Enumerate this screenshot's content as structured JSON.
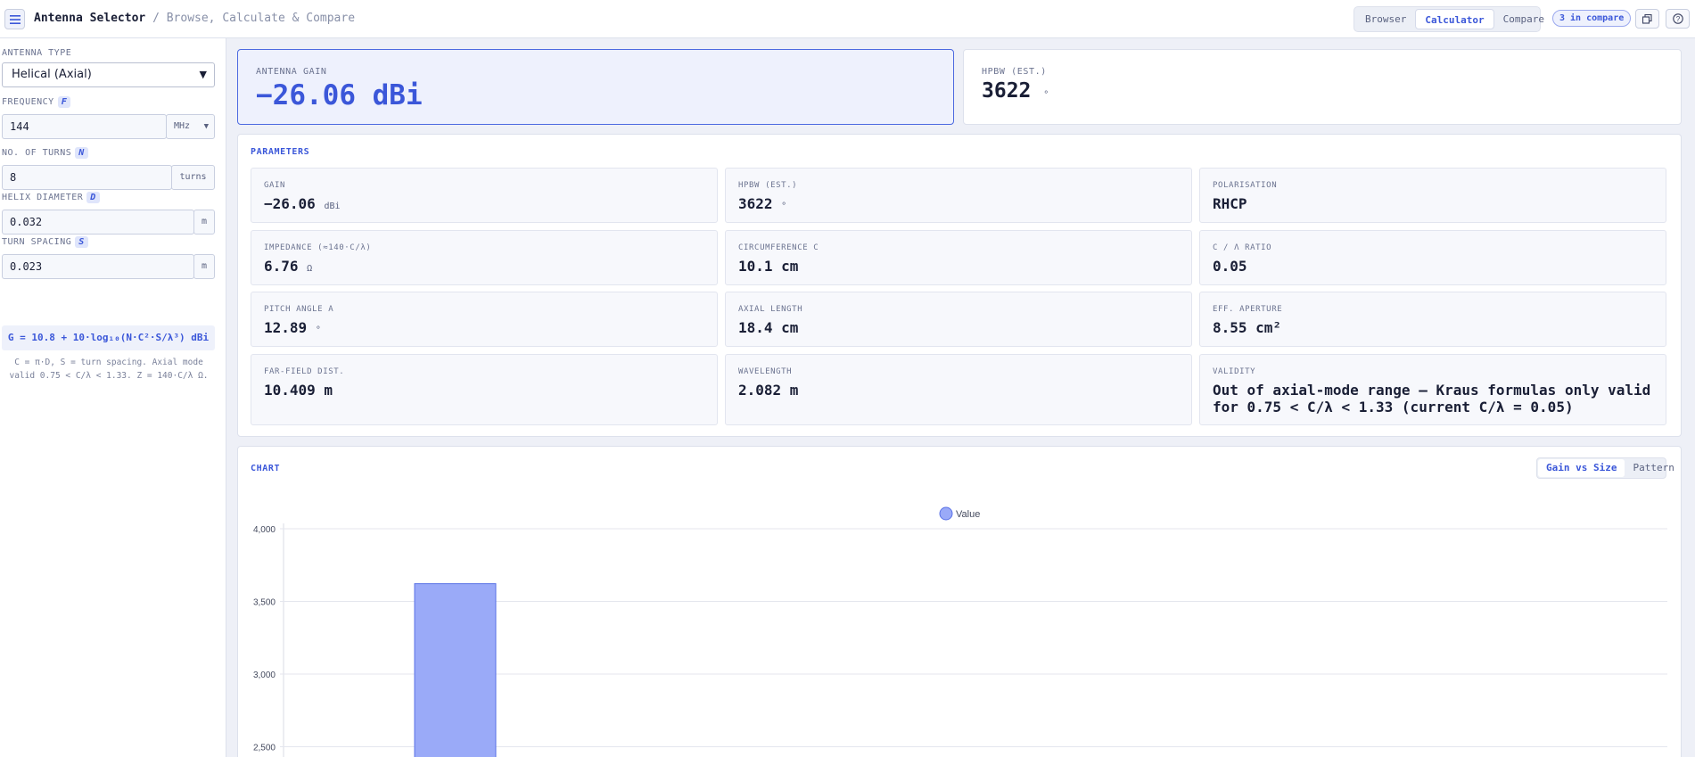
{
  "header": {
    "app_title": "Antenna Selector",
    "subtitle": "/ Browse, Calculate & Compare",
    "modes": [
      "Browser",
      "Calculator",
      "Compare"
    ],
    "active_mode": "Calculator",
    "compare_badge": "3 in compare"
  },
  "sidebar": {
    "antenna_type_label": "ANTENNA TYPE",
    "antenna_type_value": "Helical (Axial)",
    "frequency_label": "FREQUENCY",
    "frequency_var": "F",
    "frequency_value": "144",
    "frequency_unit": "MHz",
    "turns_label": "NO. OF TURNS",
    "turns_var": "N",
    "turns_value": "8",
    "turns_unit": "turns",
    "diameter_label": "HELIX DIAMETER",
    "diameter_var": "D",
    "diameter_value": "0.032",
    "diameter_unit": "m",
    "spacing_label": "TURN SPACING",
    "spacing_var": "S",
    "spacing_value": "0.023",
    "spacing_unit": "m",
    "formula": "G = 10.8 + 10·log₁₀(N·C²·S/λ³) dBi",
    "note": "C = π·D, S = turn spacing. Axial mode valid 0.75 < C/λ < 1.33. Z = 140·C/λ Ω."
  },
  "summary": {
    "gain_label": "ANTENNA GAIN",
    "gain_value": "−26.06 dBi",
    "hpbw_label": "HPBW (EST.)",
    "hpbw_value": "3622",
    "hpbw_unit": "°"
  },
  "parameters": {
    "title": "PARAMETERS",
    "items": [
      {
        "label": "GAIN",
        "value": "−26.06",
        "unit": "dBi"
      },
      {
        "label": "HPBW (EST.)",
        "value": "3622",
        "unit": "°"
      },
      {
        "label": "POLARISATION",
        "value": "RHCP",
        "unit": ""
      },
      {
        "label": "IMPEDANCE (≈140·C/λ)",
        "value": "6.76",
        "unit": "Ω"
      },
      {
        "label": "CIRCUMFERENCE C",
        "value": "10.1 cm",
        "unit": ""
      },
      {
        "label": "C / Λ RATIO",
        "value": "0.05",
        "unit": ""
      },
      {
        "label": "PITCH ANGLE Α",
        "value": "12.89",
        "unit": "°"
      },
      {
        "label": "AXIAL LENGTH",
        "value": "18.4 cm",
        "unit": ""
      },
      {
        "label": "EFF. APERTURE",
        "value": "8.55 cm²",
        "unit": ""
      },
      {
        "label": "FAR-FIELD DIST.",
        "value": "10.409 m",
        "unit": ""
      },
      {
        "label": "WAVELENGTH",
        "value": "2.082 m",
        "unit": ""
      },
      {
        "label": "VALIDITY",
        "value": "Out of axial-mode range — Kraus formulas only valid for 0.75 < C/λ < 1.33 (current C/λ = 0.05)",
        "unit": ""
      }
    ]
  },
  "chart_section": {
    "title": "CHART",
    "tabs": [
      "Gain vs Size",
      "Pattern"
    ],
    "active_tab": "Gain vs Size"
  },
  "chart_data": {
    "type": "bar",
    "categories": [
      ""
    ],
    "series": [
      {
        "name": "Value",
        "values": [
          3622
        ]
      }
    ],
    "y_ticks": [
      "2,500",
      "3,000",
      "3,500",
      "4,000"
    ],
    "ylim": [
      2500,
      4000
    ],
    "legend": "top-center",
    "grid": true,
    "bar_color": "#9aaaf8"
  }
}
